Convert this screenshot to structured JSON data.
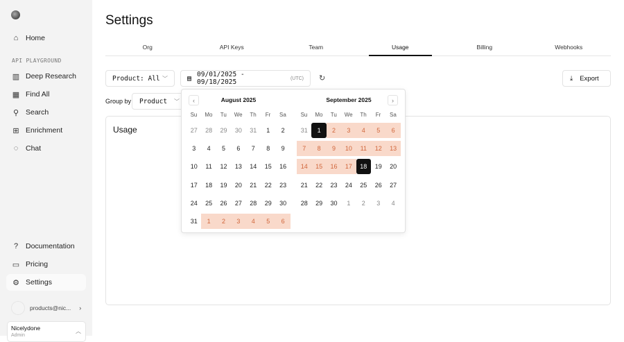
{
  "sidebar": {
    "items": [
      {
        "label": "Home",
        "icon": "home-icon",
        "g": "⌂"
      }
    ],
    "section": "API PLAYGROUND",
    "playground": [
      {
        "label": "Deep Research",
        "icon": "book-icon",
        "g": "▥"
      },
      {
        "label": "Find All",
        "icon": "table-icon",
        "g": "▦"
      },
      {
        "label": "Search",
        "icon": "search-icon",
        "g": "⚲"
      },
      {
        "label": "Enrichment",
        "icon": "blocks-icon",
        "g": "⊞"
      },
      {
        "label": "Chat",
        "icon": "chat-icon",
        "g": "◌"
      }
    ],
    "bottom": [
      {
        "label": "Documentation",
        "icon": "help-icon",
        "g": "?"
      },
      {
        "label": "Pricing",
        "icon": "pricing-icon",
        "g": "▭"
      },
      {
        "label": "Settings",
        "icon": "gear-icon",
        "g": "⚙"
      }
    ],
    "user": "products@nic...",
    "org": "Nicelydone",
    "role": "Admin"
  },
  "page": {
    "title": "Settings",
    "tabs": [
      "Org",
      "API Keys",
      "Team",
      "Usage",
      "Billing",
      "Webhooks"
    ],
    "active_tab": "Usage"
  },
  "filters": {
    "product": "Product: All",
    "date_range": "09/01/2025 - 09/18/2025",
    "tz": "(UTC)",
    "export": "Export",
    "group_by_label": "Group by",
    "group_by": "Product"
  },
  "card_title": "Usage",
  "calendar": {
    "dow": [
      "Su",
      "Mo",
      "Tu",
      "We",
      "Th",
      "Fr",
      "Sa"
    ],
    "months": [
      {
        "title": "August 2025",
        "weeks": [
          [
            27,
            28,
            29,
            30,
            31,
            1,
            2
          ],
          [
            3,
            4,
            5,
            6,
            7,
            8,
            9
          ],
          [
            10,
            11,
            12,
            13,
            14,
            15,
            16
          ],
          [
            17,
            18,
            19,
            20,
            21,
            22,
            23
          ],
          [
            24,
            25,
            26,
            27,
            28,
            29,
            30
          ],
          [
            31,
            1,
            2,
            3,
            4,
            5,
            6
          ]
        ],
        "states": [
          "ooooonn",
          "nnnnnnn",
          "nnnnnnn",
          "nnnnnnn",
          "nnnnnnn",
          "nrrrrrr"
        ]
      },
      {
        "title": "September 2025",
        "weeks": [
          [
            31,
            1,
            2,
            3,
            4,
            5,
            6
          ],
          [
            7,
            8,
            9,
            10,
            11,
            12,
            13
          ],
          [
            14,
            15,
            16,
            17,
            18,
            19,
            20
          ],
          [
            21,
            22,
            23,
            24,
            25,
            26,
            27
          ],
          [
            28,
            29,
            30,
            1,
            2,
            3,
            4
          ]
        ],
        "states": [
          "osrrrrr",
          "rrrrrrr",
          "rrrrsnn",
          "nnnnnnn",
          "nnnoooo"
        ]
      }
    ]
  }
}
